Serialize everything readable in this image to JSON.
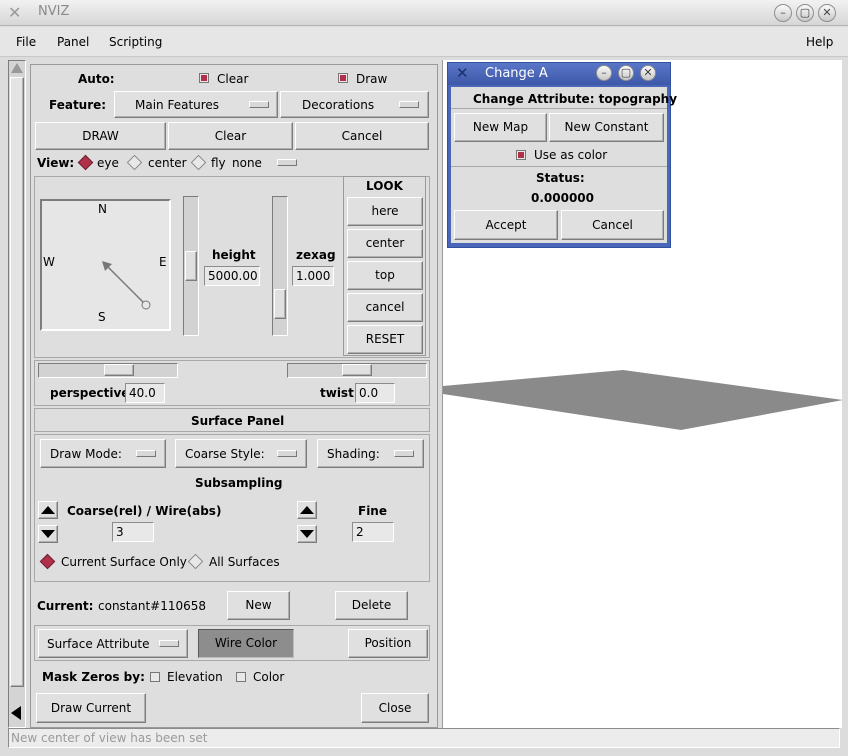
{
  "window": {
    "title": "NVIZ",
    "minimize": "–",
    "maximize": "▢",
    "close": "✕"
  },
  "menu": {
    "file": "File",
    "panel": "Panel",
    "scripting": "Scripting",
    "help": "Help"
  },
  "auto": {
    "label": "Auto:",
    "clear": "Clear",
    "draw": "Draw"
  },
  "feature": {
    "label": "Feature:",
    "main": "Main Features",
    "decorations": "Decorations"
  },
  "actions": {
    "draw": "DRAW",
    "clear": "Clear",
    "cancel": "Cancel"
  },
  "view": {
    "label": "View:",
    "eye": "eye",
    "center": "center",
    "fly": "fly",
    "none": "none"
  },
  "compass": {
    "n": "N",
    "s": "S",
    "e": "E",
    "w": "W"
  },
  "height": {
    "label": "height",
    "value": "5000.00",
    "slider_fraction": 0.5
  },
  "zexag": {
    "label": "zexag",
    "value": "1.000",
    "slider_fraction": 0.85
  },
  "look": {
    "title": "LOOK",
    "here": "here",
    "center": "center",
    "top": "top",
    "cancel": "cancel",
    "reset": "RESET"
  },
  "perspective": {
    "label": "perspective",
    "value": "40.0",
    "slider_fraction": 0.6
  },
  "twist": {
    "label": "twist",
    "value": "0.0",
    "slider_fraction": 0.5
  },
  "surface": {
    "title": "Surface Panel",
    "draw_mode": "Draw Mode:",
    "coarse_style": "Coarse Style:",
    "shading": "Shading:",
    "subsampling": "Subsampling",
    "coarse_label": "Coarse(rel) / Wire(abs)",
    "coarse_value": "3",
    "fine_label": "Fine",
    "fine_value": "2",
    "current_only": "Current Surface Only",
    "all_surfaces": "All Surfaces",
    "current_label": "Current:",
    "current_value": "constant#110658",
    "new": "New",
    "delete": "Delete",
    "surface_attribute": "Surface Attribute",
    "wire_color": "Wire Color",
    "position": "Position",
    "mask_label": "Mask Zeros by:",
    "mask_elevation": "Elevation",
    "mask_color": "Color",
    "draw_current": "Draw Current",
    "close": "Close"
  },
  "dialog": {
    "title": "Change A",
    "heading": "Change Attribute: topography",
    "new_map": "New Map",
    "new_constant": "New Constant",
    "use_as_color": "Use as color",
    "status_label": "Status:",
    "status_value": "0.000000",
    "accept": "Accept",
    "cancel": "Cancel"
  },
  "status": {
    "message": "New center of view has been set"
  },
  "colors": {
    "accent": "#b0304a",
    "dialog_title": "#4a66b8",
    "surface": "#8a8a8a"
  }
}
